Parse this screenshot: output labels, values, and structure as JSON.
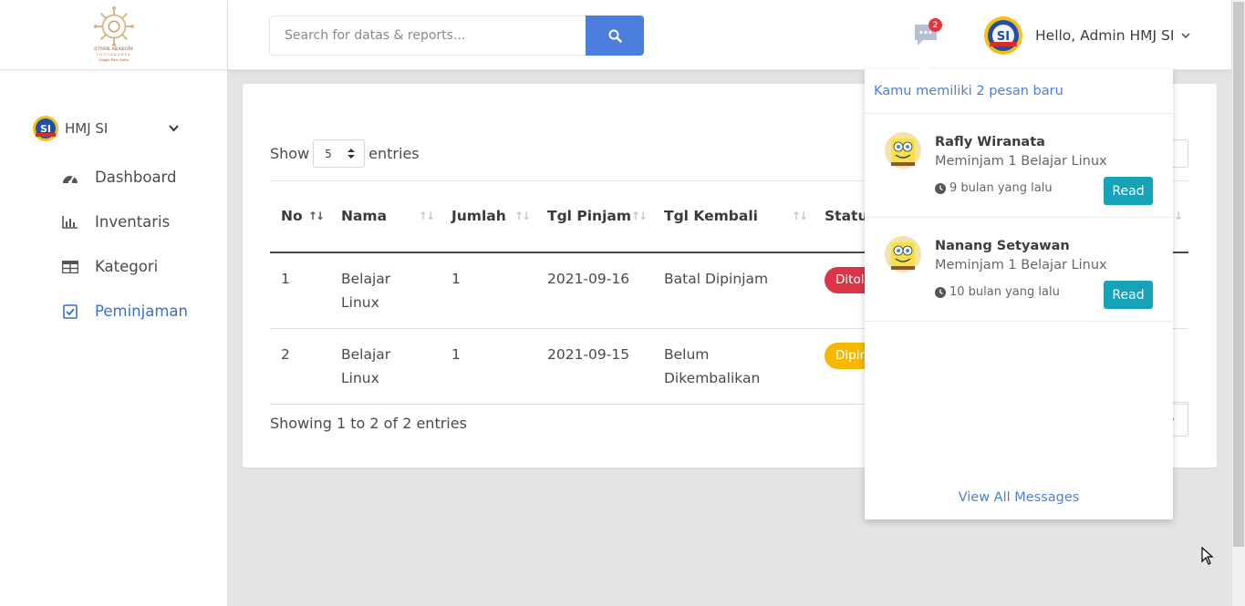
{
  "sidebar": {
    "brand_name": "STMIK AKAKOM",
    "brand_sub": "YOGYAKARTA",
    "brand_tag": "Cagar Pari Suka",
    "org_name": "HMJ SI",
    "items": [
      {
        "label": "Dashboard",
        "icon": "dashboard-icon"
      },
      {
        "label": "Inventaris",
        "icon": "bar-chart-icon"
      },
      {
        "label": "Kategori",
        "icon": "table-icon"
      },
      {
        "label": "Peminjaman",
        "icon": "checkbox-icon",
        "active": true
      }
    ]
  },
  "topbar": {
    "search_placeholder": "Search for datas & reports...",
    "message_count": "2",
    "user_greeting": "Hello, Admin HMJ SI"
  },
  "table": {
    "show_label": "Show",
    "entries_value": "5",
    "entries_label": "entries",
    "columns": [
      "No",
      "Nama",
      "Jumlah",
      "Tgl Pinjam",
      "Tgl Kembali",
      "Status Pinjam"
    ],
    "rows": [
      {
        "no": "1",
        "nama": "Belajar Linux",
        "jumlah": "1",
        "tgl_pinjam": "2021-09-16",
        "tgl_kembali": "Batal Dipinjam",
        "status": "Ditolak",
        "status_color": "#dc3545"
      },
      {
        "no": "2",
        "nama": "Belajar Linux",
        "jumlah": "1",
        "tgl_pinjam": "2021-09-15",
        "tgl_kembali": "Belum Dikembalikan",
        "status": "Dipinjam",
        "status_color": "#f6b900"
      }
    ],
    "showing": "Showing 1 to 2 of 2 entries"
  },
  "messages": {
    "header": "Kamu memiliki 2 pesan baru",
    "items": [
      {
        "from": "Rafly Wiranata",
        "text": "Meminjam 1 Belajar Linux",
        "time": "9 bulan yang lalu",
        "button": "Read"
      },
      {
        "from": "Nanang Setyawan",
        "text": "Meminjam 1 Belajar Linux",
        "time": "10 bulan yang lalu",
        "button": "Read"
      }
    ],
    "view_all": "View All Messages"
  },
  "colors": {
    "accent": "#4c7ee0",
    "read_button": "#17a2b8",
    "badge_danger": "#dc3545",
    "badge_warning": "#f6b900"
  }
}
